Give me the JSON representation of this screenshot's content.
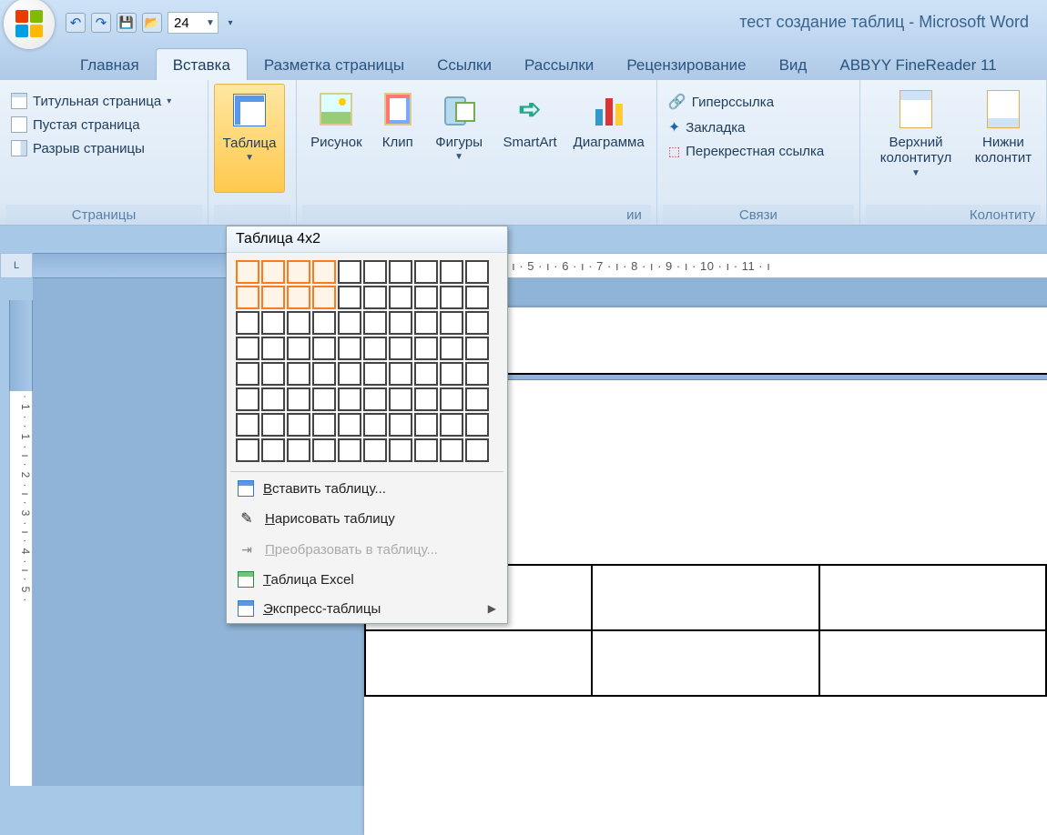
{
  "window": {
    "title": "тест создание таблиц - Microsoft Word"
  },
  "qat": {
    "font_size": "24"
  },
  "tabs": {
    "home": "Главная",
    "insert": "Вставка",
    "layout": "Разметка страницы",
    "references": "Ссылки",
    "mailings": "Рассылки",
    "review": "Рецензирование",
    "view": "Вид",
    "abbyy": "ABBYY FineReader 11"
  },
  "ribbon": {
    "pages": {
      "label": "Страницы",
      "cover": "Титульная страница",
      "blank": "Пустая страница",
      "break": "Разрыв страницы"
    },
    "tables": {
      "button": "Таблица"
    },
    "illustrations": {
      "picture": "Рисунок",
      "clip": "Клип",
      "shapes": "Фигуры",
      "smartart": "SmartArt",
      "chart": "Диаграмма",
      "label_suffix": "ии"
    },
    "links": {
      "label": "Связи",
      "hyperlink": "Гиперссылка",
      "bookmark": "Закладка",
      "crossref": "Перекрестная ссылка"
    },
    "headers": {
      "label": "Колонтиту",
      "top": "Верхний колонтитул",
      "bottom": "Нижни колонтит"
    }
  },
  "table_menu": {
    "header": "Таблица 4x2",
    "selected_cols": 4,
    "selected_rows": 2,
    "grid_cols": 10,
    "grid_rows": 8,
    "insert": "Вставить таблицу...",
    "draw": "Нарисовать таблицу",
    "convert": "Преобразовать в таблицу...",
    "excel": "Таблица Excel",
    "quick": "Экспресс-таблицы"
  },
  "ruler": {
    "h": " · 1 · ı · 2 · ı · 3 · ı · 4 · ı · 5 · ı · 6 · ı · 7 · ı · 8 · ı · 9 · ı · 10 · ı · 11 · ı",
    "v": "·1··1·ı·2·ı·3·ı·4·ı·5·"
  }
}
